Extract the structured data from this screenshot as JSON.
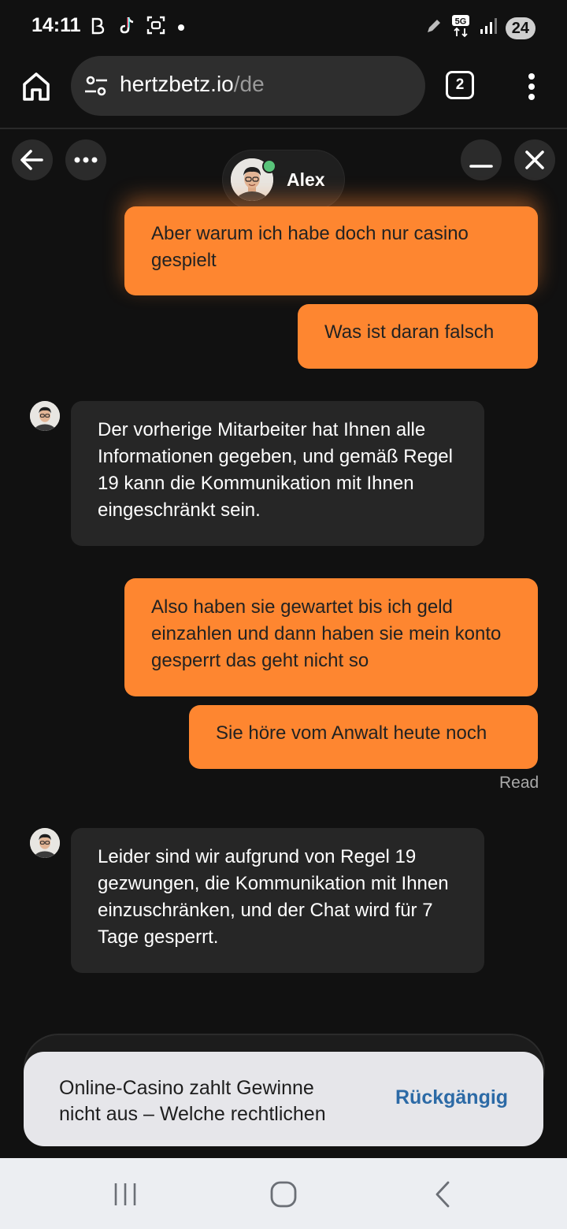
{
  "status_bar": {
    "time": "14:11",
    "network": "5G",
    "battery": "24"
  },
  "browser": {
    "url_domain": "hertzbetz.io",
    "url_path": "/de",
    "tab_count": "2"
  },
  "chat": {
    "agent_name": "Alex",
    "messages": [
      {
        "from": "user",
        "text": "Aber warum ich habe doch nur casino gespielt"
      },
      {
        "from": "user",
        "text": "Was ist daran falsch"
      },
      {
        "from": "agent",
        "text": "Der vorherige Mitarbeiter hat Ihnen alle Informationen gegeben, und gemäß Regel 19 kann die Kommunikation mit Ihnen eingeschränkt sein."
      },
      {
        "from": "user",
        "text": "Also haben sie gewartet bis ich geld einzahlen und dann haben sie mein konto gesperrt das geht nicht so"
      },
      {
        "from": "user",
        "text": "Sie höre vom Anwalt heute noch"
      },
      {
        "from": "agent",
        "text": "Leider sind wir aufgrund von Regel 19 gezwungen, die Kommunikation mit Ihnen einzuschränken, und der Chat wird für 7 Tage gesperrt."
      }
    ],
    "read_status": "Read"
  },
  "snackbar": {
    "text": "Online-Casino zahlt Gewinne nicht aus – Welche rechtlichen",
    "action": "Rückgängig"
  },
  "colors": {
    "user_bubble": "#fe8630",
    "agent_bubble": "#262626",
    "background": "#111111",
    "online": "#59c47a",
    "snack_action": "#2c6aa6"
  }
}
